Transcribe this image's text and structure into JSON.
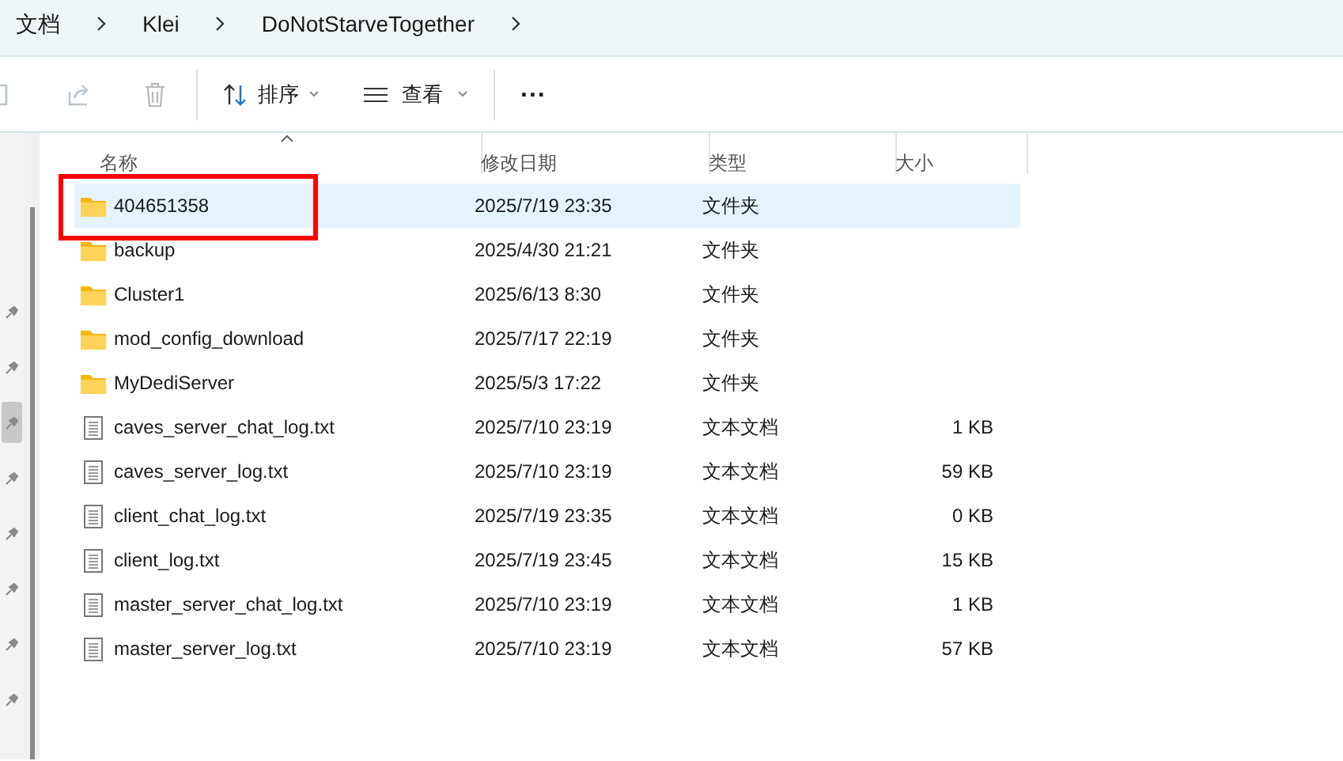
{
  "breadcrumb": [
    "文档",
    "Klei",
    "DoNotStarveTogether"
  ],
  "toolbar": {
    "sort": "排序",
    "view": "查看",
    "more": "..."
  },
  "columns": [
    "名称",
    "修改日期",
    "类型",
    "大小"
  ],
  "rows": [
    {
      "kind": "folder",
      "name": "404651358",
      "date": "2025/7/19 23:35",
      "type": "文件夹",
      "selected": true,
      "highlighted": true
    },
    {
      "kind": "folder",
      "name": "backup",
      "date": "2025/4/30 21:21",
      "type": "文件夹",
      "selected": false,
      "highlighted": false
    },
    {
      "kind": "folder",
      "name": "Cluster1",
      "date": "2025/6/13 8:30",
      "type": "文件夹",
      "selected": false,
      "highlighted": false
    },
    {
      "kind": "folder",
      "name": "mod_config_download",
      "date": "2025/7/17 22:19",
      "type": "文件夹",
      "selected": false,
      "highlighted": false
    },
    {
      "kind": "folder",
      "name": "MyDediServer",
      "date": "2025/5/3 17:22",
      "type": "文件夹",
      "selected": false,
      "highlighted": false
    },
    {
      "kind": "file",
      "name": "caves_server_chat_log.txt",
      "date": "2025/7/10 23:19",
      "type": "文本文档",
      "size": "1 KB",
      "selected": false,
      "highlighted": false
    },
    {
      "kind": "file",
      "name": "caves_server_log.txt",
      "date": "2025/7/10 23:19",
      "type": "文本文档",
      "size": "59 KB",
      "selected": false,
      "highlighted": false
    },
    {
      "kind": "file",
      "name": "client_chat_log.txt",
      "date": "2025/7/19 23:35",
      "type": "文本文档",
      "size": "0 KB",
      "selected": false,
      "highlighted": false
    },
    {
      "kind": "file",
      "name": "client_log.txt",
      "date": "2025/7/19 23:45",
      "type": "文本文档",
      "size": "15 KB",
      "selected": false,
      "highlighted": false
    },
    {
      "kind": "file",
      "name": "master_server_chat_log.txt",
      "date": "2025/7/10 23:19",
      "type": "文本文档",
      "size": "1 KB",
      "selected": false,
      "highlighted": false
    },
    {
      "kind": "file",
      "name": "master_server_log.txt",
      "date": "2025/7/10 23:19",
      "type": "文本文档",
      "size": "57 KB",
      "selected": false,
      "highlighted": false
    }
  ],
  "nav_pins": [
    {
      "selected": false
    },
    {
      "selected": false
    },
    {
      "selected": true
    },
    {
      "selected": false
    },
    {
      "selected": false
    },
    {
      "selected": false
    },
    {
      "selected": false
    },
    {
      "selected": false
    }
  ]
}
